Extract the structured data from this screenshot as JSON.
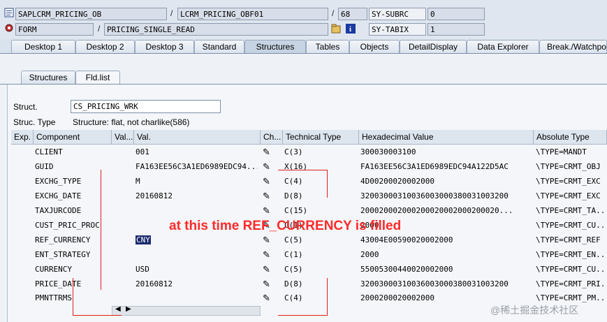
{
  "top": {
    "program": "SAPLCRM_PRICING_OB",
    "include": "LCRM_PRICING_OBF01",
    "line": "68",
    "sysubrc_label": "SY-SUBRC",
    "sysubrc_value": "0",
    "type": "FORM",
    "name": "PRICING_SINGLE_READ",
    "sytabix_label": "SY-TABIX",
    "sytabix_value": "1"
  },
  "tabs": [
    "Desktop 1",
    "Desktop 2",
    "Desktop 3",
    "Standard",
    "Structures",
    "Tables",
    "Objects",
    "DetailDisplay",
    "Data Explorer",
    "Break./Watchpo"
  ],
  "active_tab": "Structures",
  "subtabs": [
    "Structures",
    "Fld.list"
  ],
  "struct": {
    "label": "Struct.",
    "value": "CS_PRICING_WRK",
    "type_label": "Struc. Type",
    "type_value": "Structure: flat, not charlike(586)"
  },
  "table": {
    "headers": [
      "Exp.",
      "Component",
      "Val...",
      "Val.",
      "Ch...",
      "Technical Type",
      "Hexadecimal Value",
      "Absolute Type"
    ],
    "rows": [
      {
        "component": "CLIENT",
        "val": "001",
        "tech": "C(3)",
        "hex": "300030003100",
        "abs": "\\TYPE=MANDT"
      },
      {
        "component": "GUID",
        "val": "FA163EE56C3A1ED6989EDC94...",
        "tech": "X(16)",
        "hex": "FA163EE56C3A1ED6989EDC94A122D5AC",
        "abs": "\\TYPE=CRMT_OBJ"
      },
      {
        "component": "EXCHG_TYPE",
        "val": "M",
        "tech": "C(4)",
        "hex": "4D00200020002000",
        "abs": "\\TYPE=CRMT_EXC"
      },
      {
        "component": "EXCHG_DATE",
        "val": "20160812",
        "tech": "D(8)",
        "hex": "32003000310036003000380031003200",
        "abs": "\\TYPE=CRMT_EXC"
      },
      {
        "component": "TAXJURCODE",
        "val": "",
        "tech": "C(15)",
        "hex": "200020002000200020002000200020...",
        "abs": "\\TYPE=CRMT_TA..."
      },
      {
        "component": "CUST_PRIC_PROC",
        "val": "",
        "tech": "C(1)",
        "hex": "2000",
        "abs": "\\TYPE=CRMT_CU..."
      },
      {
        "component": "REF_CURRENCY",
        "val": "CNY",
        "tech": "C(5)",
        "hex": "43004E00590020002000",
        "abs": "\\TYPE=CRMT_REF"
      },
      {
        "component": "ENT_STRATEGY",
        "val": "",
        "tech": "C(1)",
        "hex": "2000",
        "abs": "\\TYPE=CRMT_EN..."
      },
      {
        "component": "CURRENCY",
        "val": "USD",
        "tech": "C(5)",
        "hex": "55005300440020002000",
        "abs": "\\TYPE=CRMT_CU..."
      },
      {
        "component": "PRICE_DATE",
        "val": "20160812",
        "tech": "D(8)",
        "hex": "32003000310036003000380031003200",
        "abs": "\\TYPE=CRMT_PRI..."
      },
      {
        "component": "PMNTTRMS",
        "val": "",
        "tech": "C(4)",
        "hex": "2000200020002000",
        "abs": "\\TYPE=CRMT_PM..."
      }
    ]
  },
  "annotation": "at this time REF_CURRENCY is filled",
  "watermark": "@稀土掘金技术社区",
  "icons": [
    "program-icon",
    "gear-icon",
    "folder-icon",
    "info-icon",
    "pencil-icon",
    "scroll-left-icon",
    "scroll-right-icon"
  ],
  "colors": {
    "accent": "#1a2a6c",
    "annotation": "#ff2a2a"
  }
}
